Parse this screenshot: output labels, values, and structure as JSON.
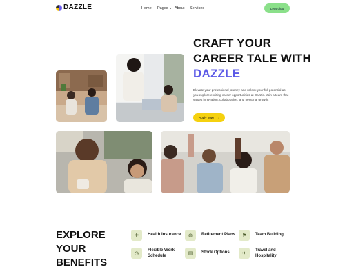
{
  "brand": {
    "name": "DAZZLE"
  },
  "nav": {
    "items": [
      {
        "label": "Home"
      },
      {
        "label": "Pages",
        "caret": "chevron-down-icon"
      },
      {
        "label": "About"
      },
      {
        "label": "Services"
      }
    ],
    "cta_label": "Let's chat"
  },
  "hero": {
    "heading_line1": "CRAFT YOUR",
    "heading_line2": "CAREER TALE WITH",
    "heading_accent": "DAZZLE",
    "paragraph": "Elevate your professional journey and unlock your full potential as you explore exciting career opportunities at Dazzle. Join a team that values innovation, collaboration, and personal growth.",
    "apply_label": "Apply now!",
    "apply_arrow": "›"
  },
  "benefits": {
    "heading_line1": "EXPLORE YOUR",
    "heading_line2": "BENEFITS",
    "items": [
      {
        "label": "Health Insurance",
        "icon": "health-icon"
      },
      {
        "label": "Retirement Plans",
        "icon": "retirement-icon"
      },
      {
        "label": "Team Building",
        "icon": "team-icon"
      },
      {
        "label": "Flexible Work Schedule",
        "icon": "schedule-icon"
      },
      {
        "label": "Stock Options",
        "icon": "stock-icon"
      },
      {
        "label": "Travel and Hospitality",
        "icon": "travel-icon"
      }
    ]
  },
  "colors": {
    "accent": "#5b59e6",
    "cta": "#8be08a",
    "apply": "#f5d10f",
    "icon_bg": "#e3eac9"
  }
}
